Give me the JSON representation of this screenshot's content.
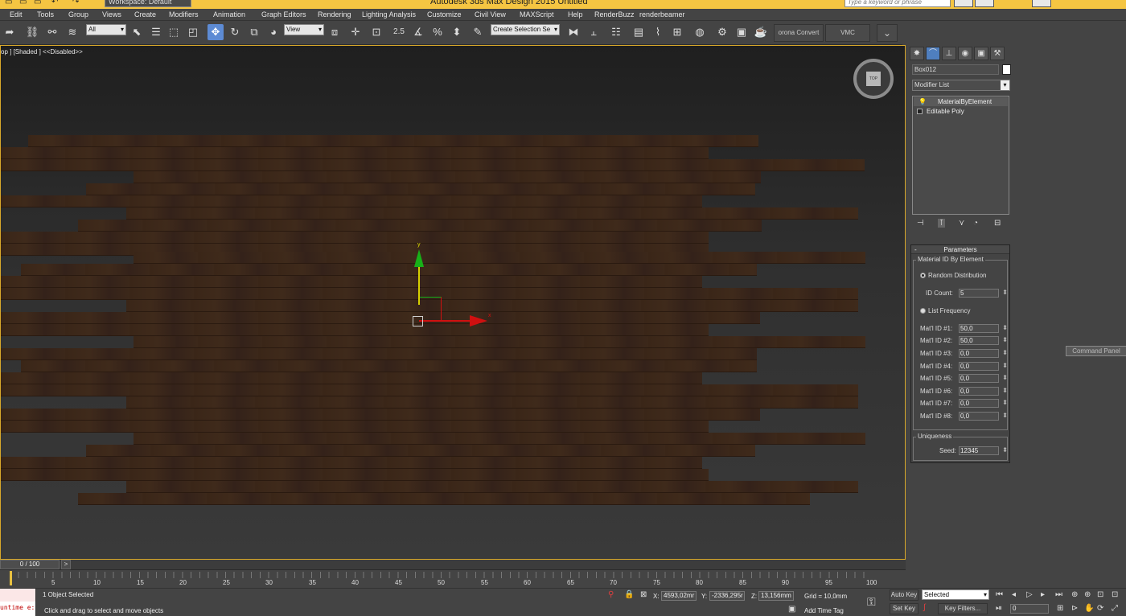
{
  "titlebar": {
    "workspace": "Workspace: Default",
    "app_title": "Autodesk 3ds Max Design 2015      Untitled",
    "search_placeholder": "Type a keyword or phrase"
  },
  "menu": [
    "Edit",
    "Tools",
    "Group",
    "Views",
    "Create",
    "Modifiers",
    "Animation",
    "Graph Editors",
    "Rendering",
    "Lighting Analysis",
    "Customize",
    "Civil View",
    "MAXScript",
    "Help",
    "RenderBuzz",
    "renderbeamer"
  ],
  "toolbar": {
    "selection_filter": "All",
    "ref_coord": "View",
    "snap_value": "2.5",
    "named_selection": "Create Selection Se",
    "corona_convert": "orona Convert",
    "vmc": "VMC"
  },
  "viewport": {
    "label": "op ] [Shaded ]  <<Disabled>>",
    "axis_y": "y",
    "axis_x": "x",
    "viewcube_face": "TOP"
  },
  "command_panel": {
    "object_name": "Box012",
    "modifier_list": "Modifier List",
    "stack": [
      "MaterialByElement",
      "Editable Poly"
    ],
    "rollout_title": "Parameters",
    "group_title": "Material ID By Element",
    "random_distribution": "Random Distribution",
    "id_count_label": "ID Count:",
    "id_count": "5",
    "list_frequency": "List Frequency",
    "mat_ids": [
      {
        "label": "Mat'l ID #1:",
        "value": "50,0"
      },
      {
        "label": "Mat'l ID #2:",
        "value": "50,0"
      },
      {
        "label": "Mat'l ID #3:",
        "value": "0,0"
      },
      {
        "label": "Mat'l ID #4:",
        "value": "0,0"
      },
      {
        "label": "Mat'l ID #5:",
        "value": "0,0"
      },
      {
        "label": "Mat'l ID #6:",
        "value": "0,0"
      },
      {
        "label": "Mat'l ID #7:",
        "value": "0,0"
      },
      {
        "label": "Mat'l ID #8:",
        "value": "0,0"
      }
    ],
    "uniqueness_title": "Uniqueness",
    "seed_label": "Seed:",
    "seed": "12345",
    "tooltip": "Command Panel"
  },
  "timeline": {
    "frame": "0 / 100",
    "next": ">",
    "ticks": [
      "5",
      "10",
      "15",
      "20",
      "25",
      "30",
      "35",
      "40",
      "45",
      "50",
      "55",
      "60",
      "65",
      "70",
      "75",
      "80",
      "85",
      "90",
      "95",
      "100"
    ]
  },
  "status": {
    "maxscript_text": "untime e:",
    "selection_info": "1 Object Selected",
    "prompt": "Click and drag to select and move objects",
    "x_label": "X:",
    "x_value": "4593,02mr",
    "y_label": "Y:",
    "y_value": "-2336,295r",
    "z_label": "Z:",
    "z_value": "13,156mm",
    "grid": "Grid = 10,0mm",
    "auto_key": "Auto Key",
    "set_key": "Set Key",
    "key_mode": "Selected",
    "key_filters": "Key Filters...",
    "add_time_tag": "Add Time Tag",
    "current_frame": "0"
  },
  "colors": {
    "titlebar": "#f5c542",
    "active_tool": "#5d8bd4",
    "viewport_border": "#d8a82a",
    "wood": "#3a2618",
    "gizmo_x": "#d01010",
    "gizmo_y": "#18b018"
  }
}
